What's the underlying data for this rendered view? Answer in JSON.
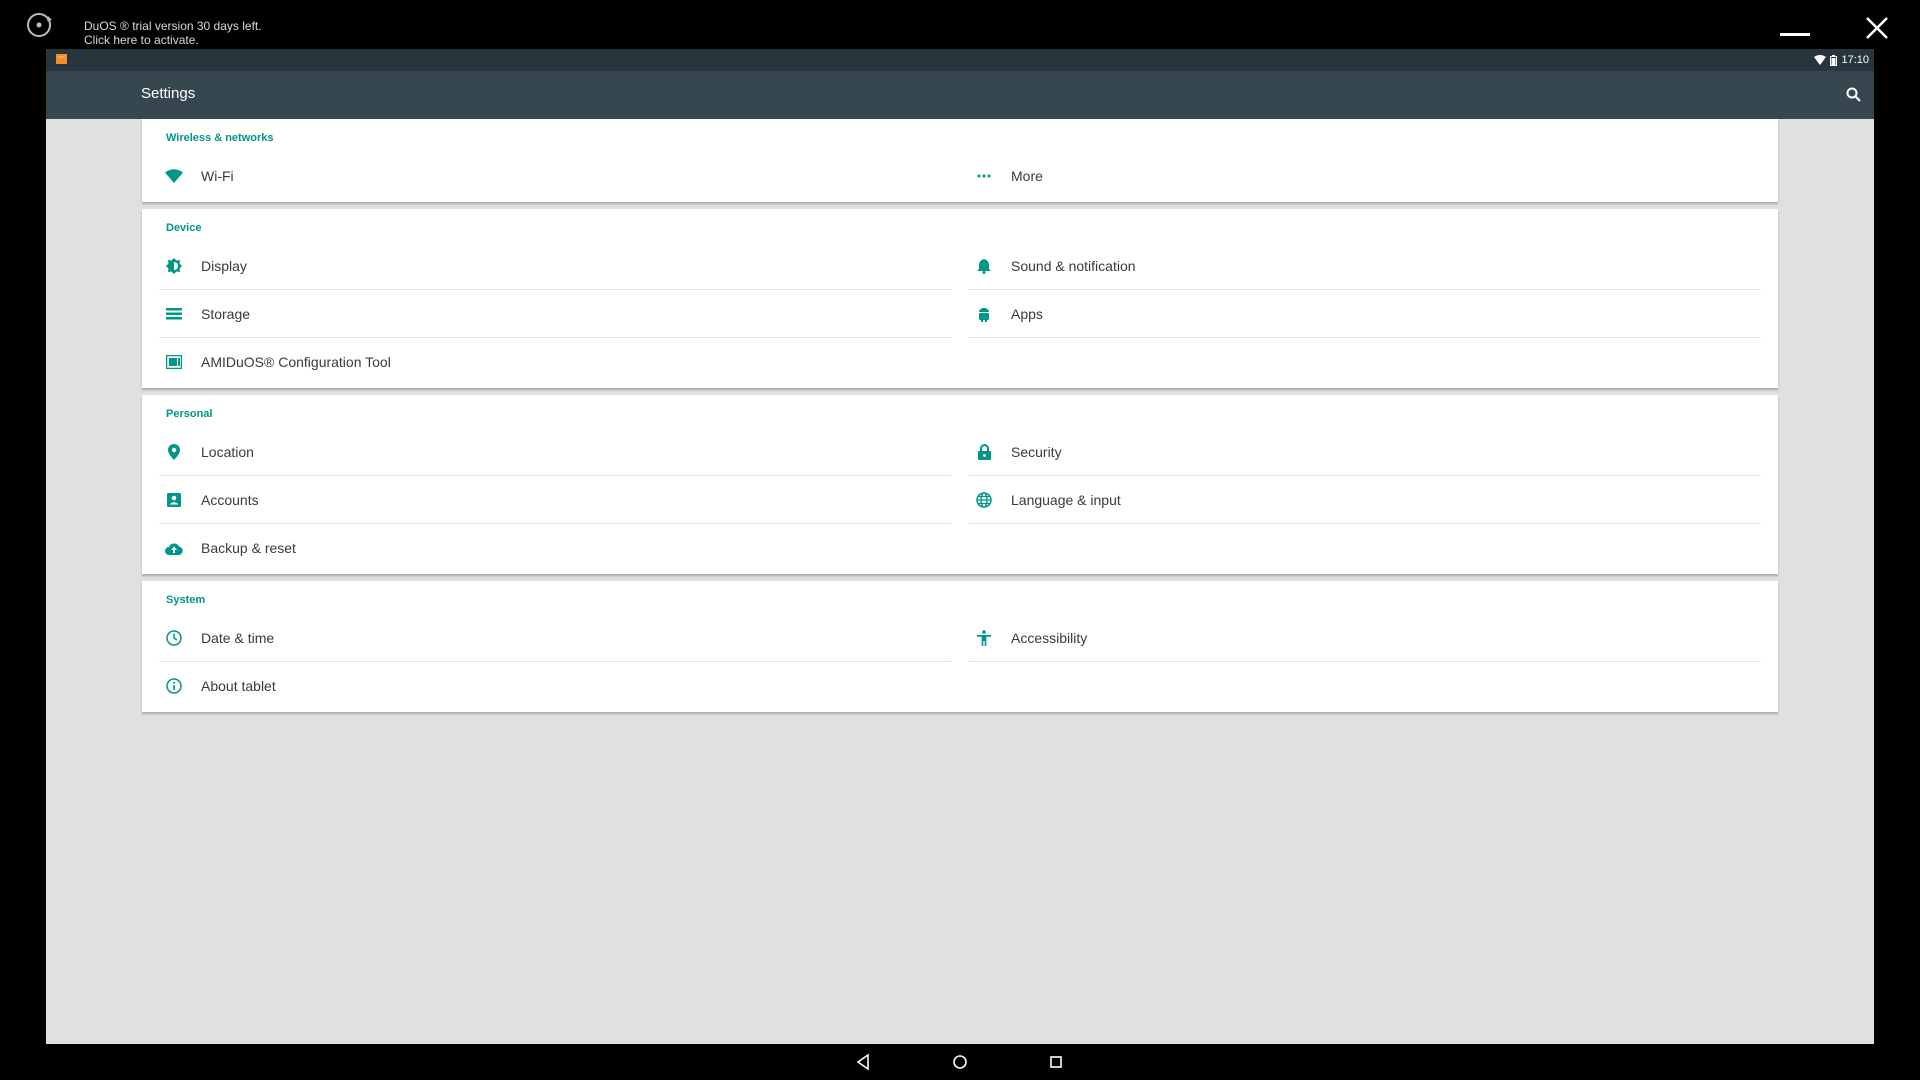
{
  "emulator": {
    "trial_line1": "DuOS ® trial version 30 days left.",
    "trial_line2": "Click here to activate."
  },
  "statusbar": {
    "time": "17:10"
  },
  "appbar": {
    "title": "Settings"
  },
  "sections": [
    {
      "title": "Wireless & networks",
      "items": [
        "Wi-Fi",
        "More"
      ]
    },
    {
      "title": "Device",
      "items": [
        "Display",
        "Sound & notification",
        "Storage",
        "Apps",
        "AMIDuOS® Configuration Tool"
      ]
    },
    {
      "title": "Personal",
      "items": [
        "Location",
        "Security",
        "Accounts",
        "Language & input",
        "Backup & reset"
      ]
    },
    {
      "title": "System",
      "items": [
        "Date & time",
        "Accessibility",
        "About tablet"
      ]
    }
  ],
  "colors": {
    "accent": "#009688",
    "appbar": "#37474f",
    "statusbar": "#27353d",
    "background": "#e0e0e0"
  }
}
